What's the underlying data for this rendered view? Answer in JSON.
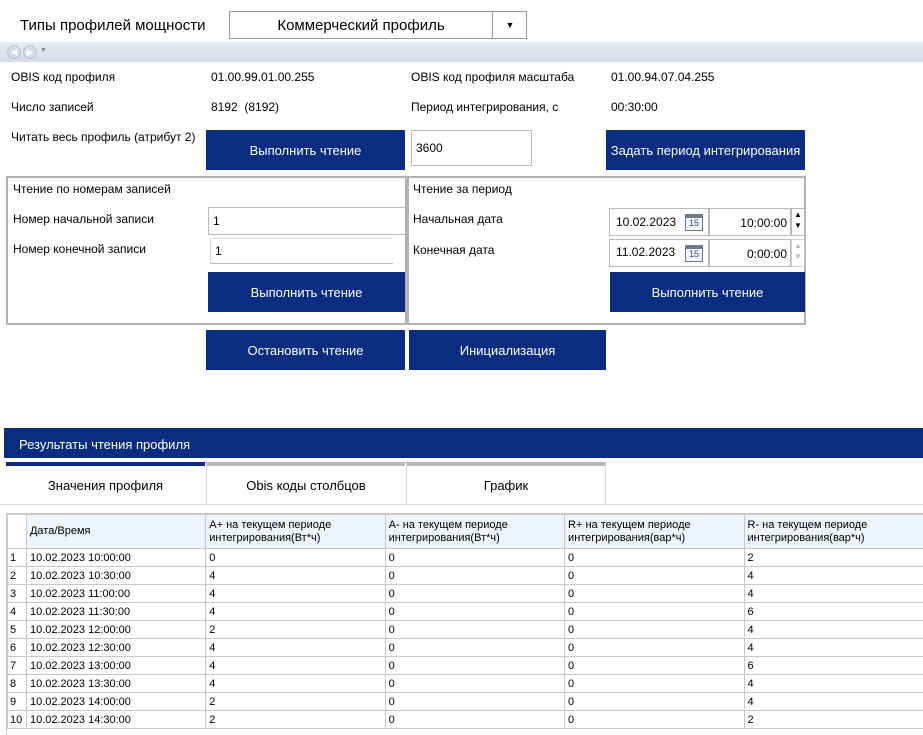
{
  "header": {
    "types_label": "Типы профилей мощности",
    "profile_selected": "Коммерческий профиль"
  },
  "info": {
    "obis_label": "OBIS код профиля",
    "obis_value": "01.00.99.01.00.255",
    "obis_scale_label": "OBIS код профиля масштаба",
    "obis_scale_value": "01.00.94.07.04.255",
    "records_label": "Число записей",
    "records_value": "8192  (8192)",
    "period_label": "Период интегрирования, с",
    "period_value": "00:30:00",
    "read_all_label": "Читать весь профиль (атрибут 2)"
  },
  "buttons": {
    "read_all": "Выполнить чтение",
    "set_period": "Задать период интегрирования",
    "read_by_number": "Выполнить чтение",
    "read_by_period": "Выполнить чтение",
    "stop": "Остановить чтение",
    "init": "Инициализация"
  },
  "period_input": "3600",
  "by_number": {
    "title": "Чтение по номерам записей",
    "start_label": "Номер начальной записи",
    "start_value": "1",
    "end_label": "Номер конечной записи",
    "end_value": "1"
  },
  "by_period": {
    "title": "Чтение за период",
    "start_label": "Начальная дата",
    "start_date": "10.02.2023",
    "start_time": "10:00:00",
    "end_label": "Конечная дата",
    "end_date": "11.02.2023",
    "end_time": "0:00:00",
    "calendar_day": "15"
  },
  "results": {
    "title": "Результаты чтения профиля",
    "tabs": [
      "Значения профиля",
      "Obis коды столбцов",
      "График"
    ]
  },
  "table": {
    "columns": [
      "Дата/Время",
      "A+ на текущем периоде интегрирования(Вт*ч)",
      "A- на текущем периоде интегрирования(Вт*ч)",
      "R+ на текущем периоде интегрирования(вар*ч)",
      "R- на текущем периоде интегрирования(вар*ч)"
    ],
    "rows": [
      [
        "1",
        "10.02.2023 10:00:00",
        "0",
        "0",
        "0",
        "2"
      ],
      [
        "2",
        "10.02.2023 10:30:00",
        "4",
        "0",
        "0",
        "4"
      ],
      [
        "3",
        "10.02.2023 11:00:00",
        "4",
        "0",
        "0",
        "4"
      ],
      [
        "4",
        "10.02.2023 11:30:00",
        "4",
        "0",
        "0",
        "6"
      ],
      [
        "5",
        "10.02.2023 12:00:00",
        "2",
        "0",
        "0",
        "4"
      ],
      [
        "6",
        "10.02.2023 12:30:00",
        "4",
        "0",
        "0",
        "4"
      ],
      [
        "7",
        "10.02.2023 13:00:00",
        "4",
        "0",
        "0",
        "6"
      ],
      [
        "8",
        "10.02.2023 13:30:00",
        "4",
        "0",
        "0",
        "4"
      ],
      [
        "9",
        "10.02.2023 14:00:00",
        "2",
        "0",
        "0",
        "4"
      ],
      [
        "10",
        "10.02.2023 14:30:00",
        "2",
        "0",
        "0",
        "2"
      ]
    ]
  },
  "colors": {
    "accent": "#0a2d82",
    "border": "#b2b2b2",
    "header_bg": "#eef4fb"
  }
}
